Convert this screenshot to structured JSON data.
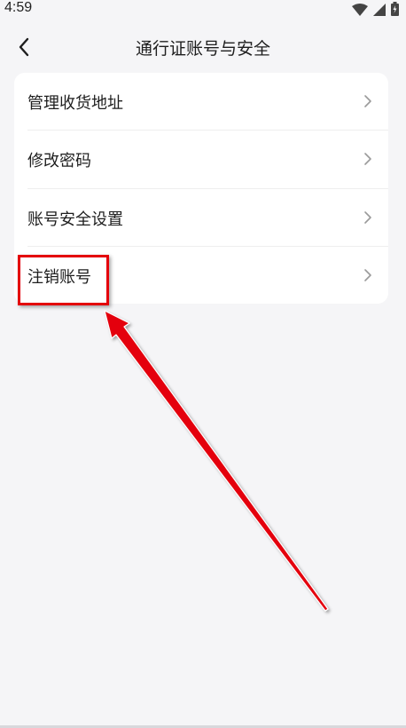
{
  "status_bar": {
    "time": "4:59"
  },
  "nav": {
    "title": "通行证账号与安全"
  },
  "settings": {
    "items": [
      {
        "label": "管理收货地址"
      },
      {
        "label": "修改密码"
      },
      {
        "label": "账号安全设置"
      },
      {
        "label": "注销账号"
      }
    ]
  },
  "annotation": {
    "color": "#e4000b",
    "highlighted_item": "注销账号"
  },
  "icons": {
    "back": "chevron-left-icon",
    "row": "chevron-right-icon",
    "wifi": "wifi-icon",
    "signal": "signal-icon",
    "battery": "battery-icon"
  }
}
